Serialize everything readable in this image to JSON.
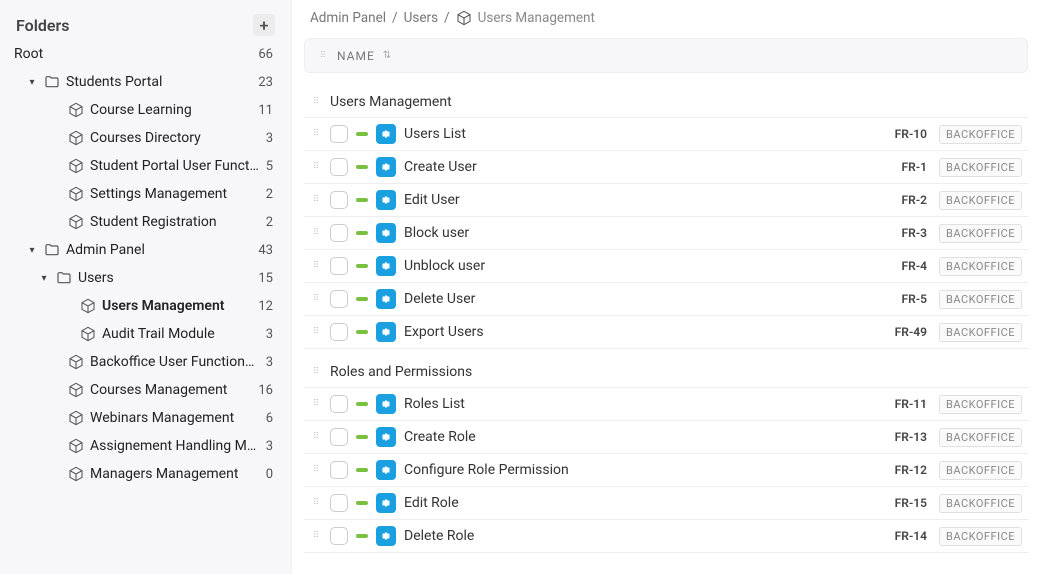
{
  "sidebar": {
    "title": "Folders",
    "root": {
      "label": "Root",
      "count": "66"
    },
    "items": [
      {
        "label": "Students Portal",
        "count": "23",
        "icon": "folder",
        "hasChevron": true,
        "indent": 1
      },
      {
        "label": "Course Learning",
        "count": "11",
        "icon": "cube",
        "indent": 2
      },
      {
        "label": "Courses Directory",
        "count": "3",
        "icon": "cube",
        "indent": 2
      },
      {
        "label": "Student Portal User Functionalities",
        "count": "5",
        "icon": "cube",
        "indent": 2
      },
      {
        "label": "Settings Management",
        "count": "2",
        "icon": "cube",
        "indent": 2
      },
      {
        "label": "Student Registration",
        "count": "2",
        "icon": "cube",
        "indent": 2
      },
      {
        "label": "Admin Panel",
        "count": "43",
        "icon": "folder",
        "hasChevron": true,
        "indent": 1
      },
      {
        "label": "Users",
        "count": "15",
        "icon": "folder",
        "hasChevron": true,
        "indent": 3
      },
      {
        "label": "Users Management",
        "count": "12",
        "icon": "cube",
        "indent": 4,
        "bold": true
      },
      {
        "label": "Audit Trail Module",
        "count": "3",
        "icon": "cube",
        "indent": 4
      },
      {
        "label": "Backoffice User Functionality",
        "count": "3",
        "icon": "cube",
        "indent": 2
      },
      {
        "label": "Courses Management",
        "count": "16",
        "icon": "cube",
        "indent": 2
      },
      {
        "label": "Webinars Management",
        "count": "6",
        "icon": "cube",
        "indent": 2
      },
      {
        "label": "Assignement Handling Module",
        "count": "3",
        "icon": "cube",
        "indent": 2
      },
      {
        "label": "Managers Management",
        "count": "0",
        "icon": "cube",
        "indent": 2
      }
    ]
  },
  "breadcrumb": {
    "a": "Admin Panel",
    "sep": "/",
    "b": "Users",
    "c": "Users Management"
  },
  "header": {
    "name": "NAME"
  },
  "sections": [
    {
      "title": "Users Management",
      "items": [
        {
          "title": "Users List",
          "code": "FR-10",
          "tag": "BACKOFFICE"
        },
        {
          "title": "Create User",
          "code": "FR-1",
          "tag": "BACKOFFICE"
        },
        {
          "title": "Edit User",
          "code": "FR-2",
          "tag": "BACKOFFICE"
        },
        {
          "title": "Block user",
          "code": "FR-3",
          "tag": "BACKOFFICE"
        },
        {
          "title": "Unblock user",
          "code": "FR-4",
          "tag": "BACKOFFICE"
        },
        {
          "title": "Delete User",
          "code": "FR-5",
          "tag": "BACKOFFICE"
        },
        {
          "title": "Export Users",
          "code": "FR-49",
          "tag": "BACKOFFICE"
        }
      ]
    },
    {
      "title": "Roles and Permissions",
      "items": [
        {
          "title": "Roles List",
          "code": "FR-11",
          "tag": "BACKOFFICE"
        },
        {
          "title": "Create Role",
          "code": "FR-13",
          "tag": "BACKOFFICE"
        },
        {
          "title": "Configure Role Permission",
          "code": "FR-12",
          "tag": "BACKOFFICE"
        },
        {
          "title": "Edit Role",
          "code": "FR-15",
          "tag": "BACKOFFICE"
        },
        {
          "title": "Delete Role",
          "code": "FR-14",
          "tag": "BACKOFFICE"
        }
      ]
    }
  ]
}
